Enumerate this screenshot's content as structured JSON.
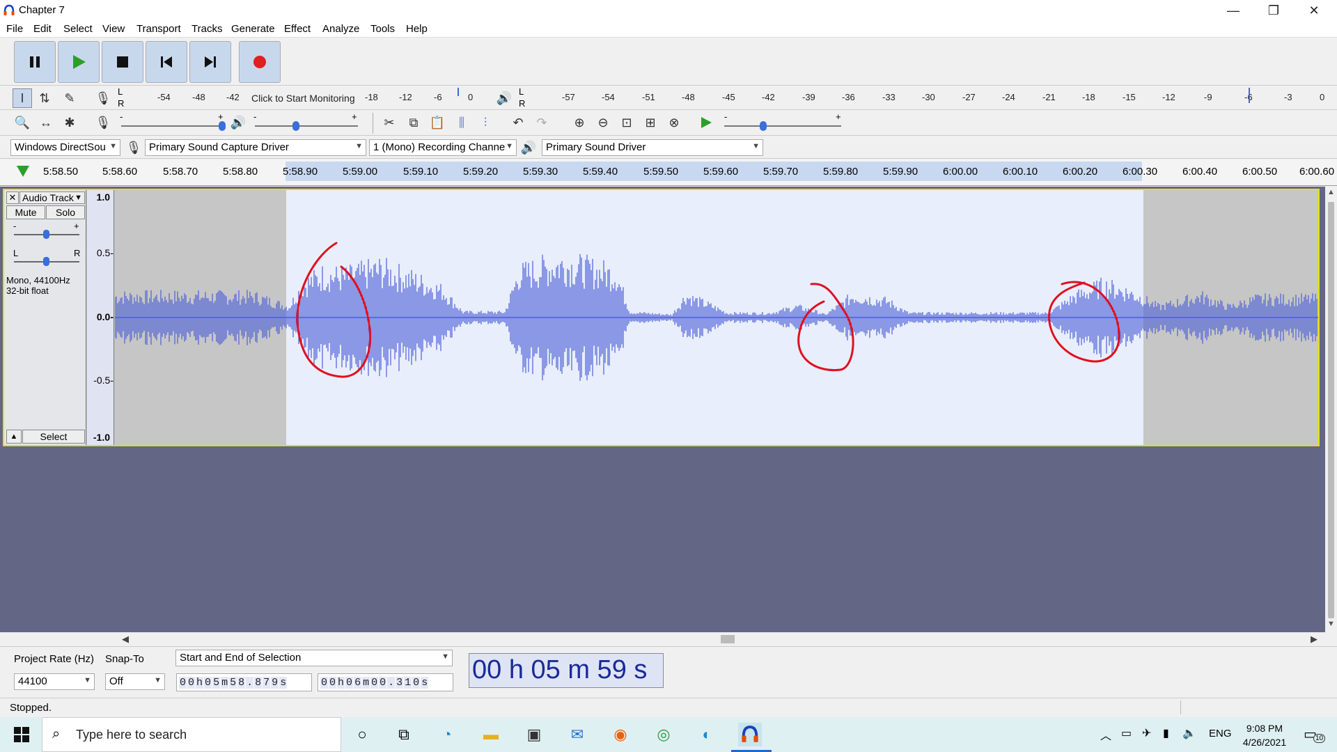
{
  "window": {
    "title": "Chapter 7",
    "minimize": "—",
    "restore": "❐",
    "close": "✕"
  },
  "menu": [
    "File",
    "Edit",
    "Select",
    "View",
    "Transport",
    "Tracks",
    "Generate",
    "Effect",
    "Analyze",
    "Tools",
    "Help"
  ],
  "transport": {
    "pause": "pause-icon",
    "play": "play-icon",
    "stop": "stop-icon",
    "skip_start": "skip-start-icon",
    "skip_end": "skip-end-icon",
    "record": "record-icon"
  },
  "record_meter": {
    "l": "L",
    "r": "R",
    "ticks": [
      "-54",
      "-48",
      "-42",
      "-18",
      "-12",
      "-6",
      "0"
    ],
    "monitor_text": "Click to Start Monitoring"
  },
  "play_meter": {
    "l": "L",
    "r": "R",
    "ticks": [
      "-57",
      "-54",
      "-51",
      "-48",
      "-45",
      "-42",
      "-39",
      "-36",
      "-33",
      "-30",
      "-27",
      "-24",
      "-21",
      "-18",
      "-15",
      "-12",
      "-9",
      "-6",
      "-3",
      "0"
    ]
  },
  "devices": {
    "host": "Windows DirectSou",
    "recording": "Primary Sound Capture Driver",
    "channels": "1 (Mono) Recording Channe",
    "playback": "Primary Sound Driver"
  },
  "timeline": [
    "5:58.50",
    "5:58.60",
    "5:58.70",
    "5:58.80",
    "5:58.90",
    "5:59.00",
    "5:59.10",
    "5:59.20",
    "5:59.30",
    "5:59.40",
    "5:59.50",
    "5:59.60",
    "5:59.70",
    "5:59.80",
    "5:59.90",
    "6:00.00",
    "6:00.10",
    "6:00.20",
    "6:00.30",
    "6:00.40",
    "6:00.50",
    "6:00.60"
  ],
  "track": {
    "name": "Audio Track",
    "mute": "Mute",
    "solo": "Solo",
    "gain_minus": "-",
    "gain_plus": "+",
    "pan_l": "L",
    "pan_r": "R",
    "info1": "Mono, 44100Hz",
    "info2": "32-bit float",
    "select": "Select",
    "close": "✕"
  },
  "vruler": [
    "1.0",
    "0.5-",
    "0.0-",
    "-0.5-",
    "-1.0"
  ],
  "bottom": {
    "rate_label": "Project Rate (Hz)",
    "rate_value": "44100",
    "snap_label": "Snap-To",
    "snap_value": "Off",
    "selection_mode": "Start and End of Selection",
    "sel_start": [
      "0",
      "0",
      "h",
      "0",
      "5",
      "m",
      "5",
      "8",
      ".",
      "8",
      "7",
      "9",
      "s"
    ],
    "sel_end": [
      "0",
      "0",
      "h",
      "0",
      "6",
      "m",
      "0",
      "0",
      ".",
      "3",
      "1",
      "0",
      "s"
    ],
    "big_time": "00 h 05 m 59 s"
  },
  "status": "Stopped.",
  "taskbar": {
    "search_placeholder": "Type here to search",
    "time": "9:08 PM",
    "date": "4/26/2021",
    "lang": "ENG",
    "notif_count": "10"
  },
  "colors": {
    "waveform": "#4b5fd6",
    "selection": "#e9eefc",
    "unselected": "#c6c6c6",
    "track_border": "#e8e000",
    "annotation": "#e01020",
    "bg_tracks": "#636685"
  }
}
